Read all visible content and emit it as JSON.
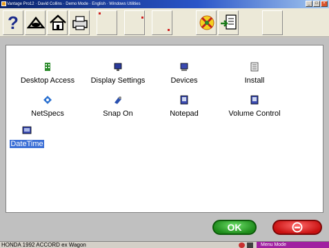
{
  "window": {
    "title": "Vantage Pro12 · David Collins · Demo Mode · English · Windows Utilities",
    "controls": [
      "_",
      "□",
      "×"
    ]
  },
  "toolbar": {
    "buttons": [
      "help",
      "car-lift",
      "home",
      "printer",
      "blank1",
      "blank2",
      "blank3",
      "tools",
      "document-import",
      "blank4"
    ],
    "help_glyph": "?"
  },
  "icons": [
    {
      "label": "Desktop Access",
      "icon": "building-icon"
    },
    {
      "label": "Display Settings",
      "icon": "monitor-icon"
    },
    {
      "label": "Devices",
      "icon": "devices-icon"
    },
    {
      "label": "Install",
      "icon": "install-icon"
    },
    {
      "label": "NetSpecs",
      "icon": "network-icon"
    },
    {
      "label": "Snap On",
      "icon": "snapon-icon"
    },
    {
      "label": "Notepad",
      "icon": "notepad-icon"
    },
    {
      "label": "Volume Control",
      "icon": "volume-icon"
    },
    {
      "label": "DateTime",
      "icon": "datetime-icon",
      "selected": true
    }
  ],
  "buttons": {
    "ok_label": "OK",
    "cancel_icon": "no-entry-icon"
  },
  "statusbar": {
    "vehicle": "HONDA  1992  ACCORD  ex  Wagon",
    "mode": "Menu Mode"
  },
  "colors": {
    "ok_green": "#1d8a1a",
    "cancel_red": "#c81010",
    "selection_blue": "#3b6fd6",
    "mode_purple": "#a020a0"
  }
}
